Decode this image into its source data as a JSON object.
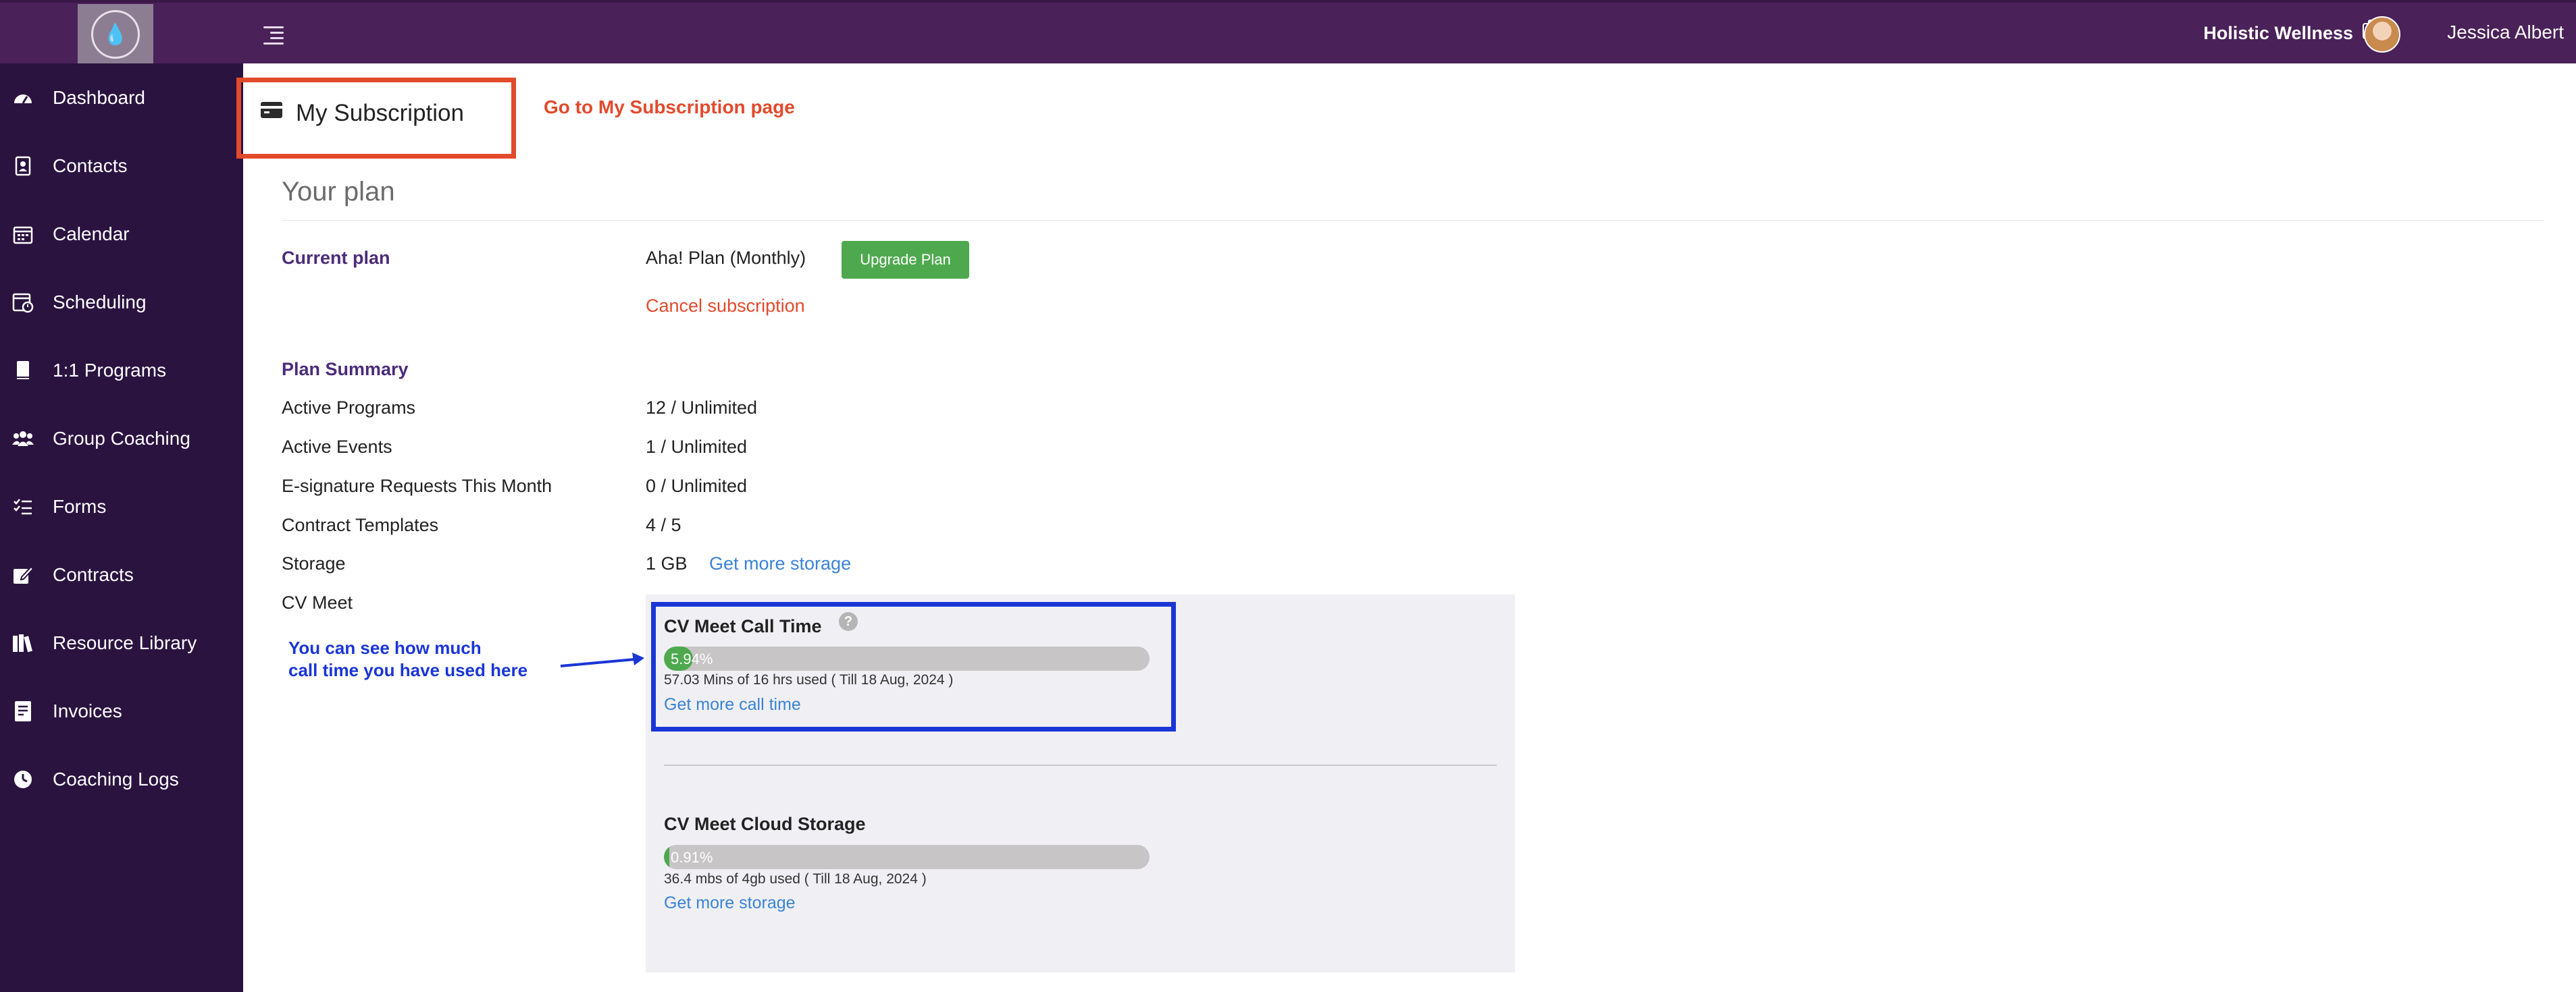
{
  "header": {
    "brand": "Holistic Wellness",
    "user_name": "Jessica Albert",
    "icons": [
      "logo-icon",
      "menu-toggle-icon",
      "briefcase-icon",
      "avatar"
    ]
  },
  "sidebar": {
    "items": [
      {
        "label": "Dashboard",
        "icon": "speedometer-icon"
      },
      {
        "label": "Contacts",
        "icon": "contact-card-icon"
      },
      {
        "label": "Calendar",
        "icon": "calendar-icon"
      },
      {
        "label": "Scheduling",
        "icon": "calendar-clock-icon"
      },
      {
        "label": "1:1 Programs",
        "icon": "book-icon"
      },
      {
        "label": "Group Coaching",
        "icon": "group-icon"
      },
      {
        "label": "Forms",
        "icon": "checklist-icon"
      },
      {
        "label": "Contracts",
        "icon": "signature-icon"
      },
      {
        "label": "Resource Library",
        "icon": "library-icon"
      },
      {
        "label": "Invoices",
        "icon": "invoice-icon"
      },
      {
        "label": "Coaching Logs",
        "icon": "clock-icon"
      }
    ]
  },
  "page": {
    "title": "My Subscription",
    "annotation_red": "Go to My Subscription page",
    "section_title": "Your plan",
    "current_plan_label": "Current plan",
    "current_plan_value": "Aha! Plan (Monthly)",
    "upgrade_button": "Upgrade Plan",
    "cancel_link": "Cancel subscription",
    "plan_summary_label": "Plan Summary",
    "summary": [
      {
        "label": "Active Programs",
        "value": "12 / Unlimited"
      },
      {
        "label": "Active Events",
        "value": "1 / Unlimited"
      },
      {
        "label": "E-signature Requests This Month",
        "value": "0 / Unlimited"
      },
      {
        "label": "Contract Templates",
        "value": "4 / 5"
      },
      {
        "label": "Storage",
        "value": "1 GB",
        "link": "Get more storage"
      },
      {
        "label": "CV Meet"
      }
    ]
  },
  "cv_meet": {
    "call_time": {
      "title": "CV Meet Call Time",
      "help": "?",
      "percent_label": "5.94%",
      "percent": 5.94,
      "usage": "57.03 Mins of 16 hrs used ( Till 18 Aug, 2024 )",
      "link": "Get more call time"
    },
    "cloud_storage": {
      "title": "CV Meet Cloud Storage",
      "percent_label": "0.91%",
      "percent": 0.91,
      "usage": "36.4 mbs of 4gb used ( Till 18 Aug, 2024 )",
      "link": "Get more storage"
    },
    "annotation_blue_line1": "You can see how much",
    "annotation_blue_line2": "call time you have used here"
  },
  "colors": {
    "topbar": "#4a2159",
    "sidebar": "#2b1340",
    "accent_green": "#4ea94e",
    "annotation_red": "#e24a2c",
    "annotation_blue": "#1a36d6",
    "link_blue": "#3a83d6"
  }
}
